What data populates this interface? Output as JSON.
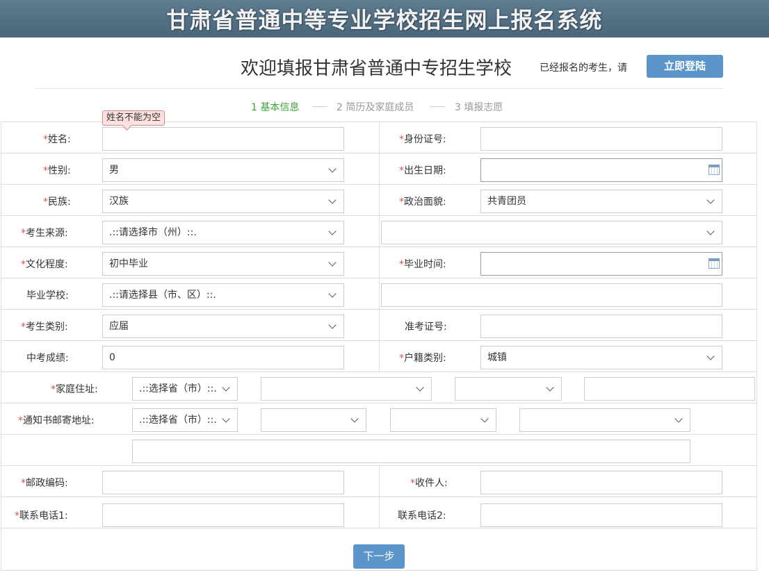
{
  "banner": {
    "title": "甘肃省普通中等专业学校招生网上报名系统"
  },
  "header": {
    "welcome": "欢迎填报甘肃省普通中专招生学校",
    "login_hint": "已经报名的考生，请",
    "login_button": "立即登陆"
  },
  "steps": [
    {
      "label": "1 基本信息",
      "active": true
    },
    {
      "label": "2 简历及家庭成员",
      "active": false
    },
    {
      "label": "3 填报志愿",
      "active": false
    }
  ],
  "validation": {
    "name_error": "姓名不能为空"
  },
  "form": {
    "required_mark": "*",
    "name": {
      "label": "姓名:",
      "value": ""
    },
    "id_number": {
      "label": "身份证号:",
      "value": ""
    },
    "gender": {
      "label": "性别:",
      "value": "男"
    },
    "birth_date": {
      "label": "出生日期:",
      "value": ""
    },
    "ethnicity": {
      "label": "民族:",
      "value": "汉族"
    },
    "political_status": {
      "label": "政治面貌:",
      "value": "共青团员"
    },
    "source": {
      "label": "考生来源:",
      "city_value": ".::请选择市（州）::.",
      "district_value": ""
    },
    "education": {
      "label": "文化程度:",
      "value": "初中毕业"
    },
    "grad_time": {
      "label": "毕业时间:",
      "value": ""
    },
    "grad_school": {
      "label": "毕业学校:",
      "county_value": ".::请选择县（市、区）::.",
      "school_value": ""
    },
    "category": {
      "label": "考生类别:",
      "value": "应届"
    },
    "exam_ticket": {
      "label": "准考证号:",
      "value": ""
    },
    "exam_score": {
      "label": "中考成绩:",
      "value": "0"
    },
    "household": {
      "label": "户籍类别:",
      "value": "城镇"
    },
    "home_address": {
      "label": "家庭住址:",
      "province_value": ".::选择省（市）::.",
      "city_value": "",
      "county_value": "",
      "detail_value": ""
    },
    "mail_address": {
      "label": "通知书邮寄地址:",
      "province_value": ".::选择省（市）::.",
      "city_value": "",
      "county_value": "",
      "town_value": "",
      "detail_value": ""
    },
    "postcode": {
      "label": "邮政编码:",
      "value": ""
    },
    "recipient": {
      "label": "收件人:",
      "value": ""
    },
    "phone1": {
      "label": "联系电话1:",
      "value": ""
    },
    "phone2": {
      "label": "联系电话2:",
      "value": ""
    },
    "next_button": "下一步"
  }
}
